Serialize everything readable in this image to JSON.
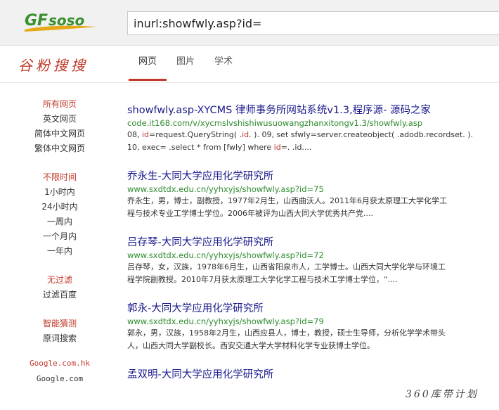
{
  "brand": {
    "logo_text": "GFsoso",
    "name_cn": "谷粉搜搜",
    "logo_color": "#3a8f2f",
    "accent_color": "#c0392b"
  },
  "search": {
    "query": "inurl:showfwly.asp?id="
  },
  "tabs": [
    {
      "label": "网页",
      "active": true
    },
    {
      "label": "图片",
      "active": false
    },
    {
      "label": "学术",
      "active": false
    }
  ],
  "sidebar": {
    "lang": {
      "head": "所有网页",
      "items": [
        "英文网页",
        "简体中文网页",
        "繁体中文网页"
      ]
    },
    "time": {
      "head": "不限时间",
      "items": [
        "1小时内",
        "24小时内",
        "一周内",
        "一个月内",
        "一年内"
      ]
    },
    "filter": {
      "head": "无过滤",
      "items": [
        "过滤百度"
      ]
    },
    "guess": {
      "head": "智能猜测",
      "items": [
        "原词搜索"
      ]
    },
    "domains": [
      "Google.com.hk",
      "Google.com"
    ]
  },
  "results": [
    {
      "title": "showfwly.asp-XYCMS 律师事务所网站系统v1.3,程序源- 源码之家",
      "url": "code.it168.com/v/xycmslvshishiwusuowangzhanxitongv1.3/showfwly.asp",
      "line1_parts": [
        "08, ",
        "id",
        "=request.QueryString( .",
        "id",
        ". ). 09, set sfwly=server.createobject( .adodb.recordset. )."
      ],
      "line2_parts": [
        "10, exec= .select * from [fwly] where ",
        "id",
        "=. .id...."
      ]
    },
    {
      "title": "乔永生-大同大学应用化学研究所",
      "url": "www.sxdtdx.edu.cn/yyhxyjs/showfwly.asp?id=75",
      "line1": "乔永生，男，博士，副教授，1977年2月生，山西曲沃人。2011年6月获太原理工大学化学工",
      "line2": "程与技术专业工学博士学位。2006年被评为山西大同大学优秀共产党...."
    },
    {
      "title": "吕存琴-大同大学应用化学研究所",
      "url": "www.sxdtdx.edu.cn/yyhxyjs/showfwly.asp?id=72",
      "line1": "吕存琴，女，汉族，1978年6月生，山西省阳泉市人，工学博士。山西大同大学化学与环境工",
      "line2": "程学院副教授。2010年7月获太原理工大学化学工程与技术工学博士学位，“...."
    },
    {
      "title": "郭永-大同大学应用化学研究所",
      "url": "www.sxdtdx.edu.cn/yyhxyjs/showfwly.asp?id=79",
      "line1": "郭永，男，汉族，1958年2月生，山西应县人，博士，教授，硕士生导师，分析化学学术带头",
      "line2": "人，山西大同大学副校长。西安交通大学大学材料化学专业获博士学位。"
    },
    {
      "title": "孟双明-大同大学应用化学研究所"
    }
  ],
  "watermark": "360库带计划"
}
